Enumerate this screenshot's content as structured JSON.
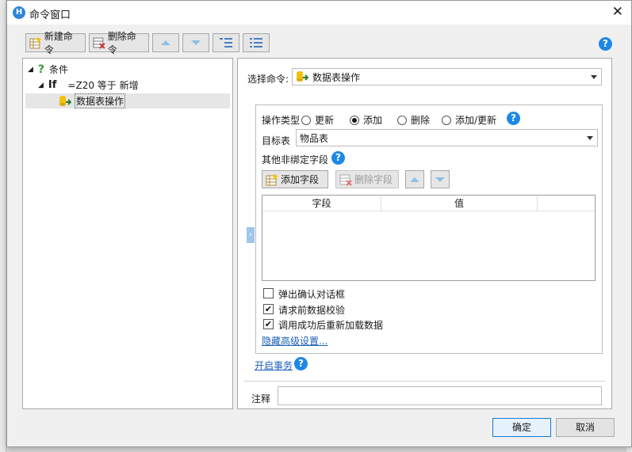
{
  "window": {
    "title": "命令窗口",
    "close": "✕"
  },
  "toolbar": {
    "new_label": "新建命令",
    "delete_label": "删除命令",
    "help": "?"
  },
  "tree": {
    "condition_label": "条件",
    "if_label": "If",
    "if_expr": "=Z20 等于 新增",
    "action_label": "数据表操作"
  },
  "right": {
    "select_label": "选择命令:",
    "select_value": "数据表操作",
    "op_type_label": "操作类型",
    "op_options": [
      "更新",
      "添加",
      "删除",
      "添加/更新"
    ],
    "op_selected": "添加",
    "target_label": "目标表",
    "target_value": "物品表",
    "unbound_label": "其他非绑定字段",
    "add_field_label": "添加字段",
    "delete_field_label": "删除字段",
    "table_columns": [
      "字段",
      "值"
    ],
    "checkboxes": [
      {
        "label": "弹出确认对话框",
        "checked": false
      },
      {
        "label": "请求前数据校验",
        "checked": true
      },
      {
        "label": "调用成功后重新加载数据",
        "checked": true
      }
    ],
    "hide_advanced": "隐藏高级设置...",
    "open_transaction": "开启事务",
    "comment_label": "注释",
    "comment_value": ""
  },
  "footer": {
    "ok_label": "确定",
    "cancel_label": "取消"
  },
  "colors": {
    "accent": "#1e88e5",
    "link": "#1a5fb4"
  }
}
